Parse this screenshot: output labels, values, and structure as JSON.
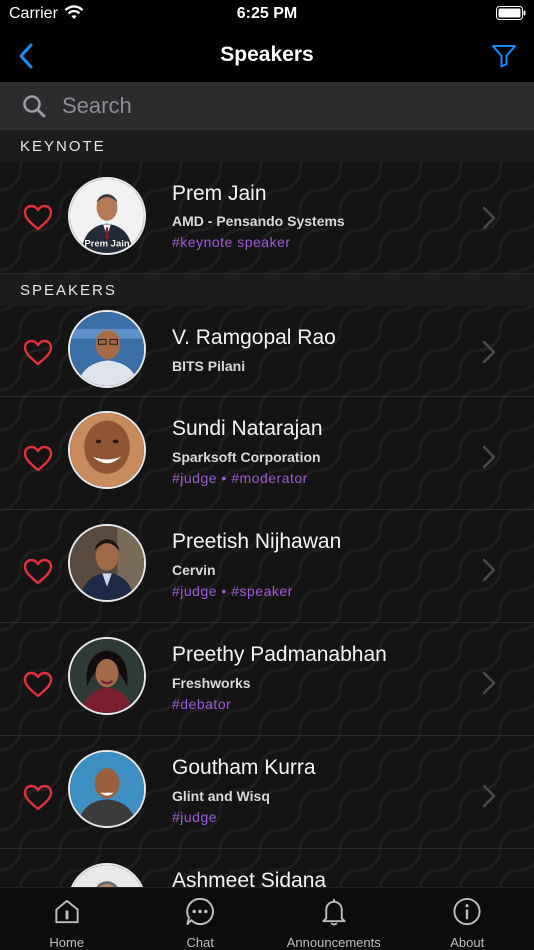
{
  "status_bar": {
    "carrier": "Carrier",
    "time": "6:25 PM"
  },
  "nav": {
    "title": "Speakers"
  },
  "search": {
    "placeholder": "Search"
  },
  "colors": {
    "accent_blue": "#1a8cff",
    "tag_purple": "#a259d6",
    "heart_red": "#e0303a"
  },
  "sections": [
    {
      "title": "KEYNOTE",
      "speakers": [
        {
          "name": "Prem  Jain",
          "org": "AMD - Pensando Systems",
          "tags": "#keynote speaker",
          "photo_caption": "Prem Jain"
        }
      ]
    },
    {
      "title": "SPEAKERS",
      "speakers": [
        {
          "name": "V. Ramgopal Rao",
          "org": "BITS Pilani",
          "tags": ""
        },
        {
          "name": "Sundi Natarajan",
          "org": "Sparksoft Corporation",
          "tags": "#judge • #moderator"
        },
        {
          "name": "Preetish Nijhawan",
          "org": "Cervin",
          "tags": "#judge • #speaker"
        },
        {
          "name": "Preethy Padmanabhan",
          "org": "Freshworks",
          "tags": "#debator"
        },
        {
          "name": "Goutham Kurra",
          "org": "Glint and Wisq",
          "tags": "#judge"
        },
        {
          "name": "Ashmeet Sidana",
          "org": "",
          "tags": ""
        }
      ]
    }
  ],
  "tab_bar": {
    "tabs": [
      {
        "label": "Home",
        "icon": "home-icon"
      },
      {
        "label": "Chat",
        "icon": "chat-icon"
      },
      {
        "label": "Announcements",
        "icon": "bell-icon"
      },
      {
        "label": "About",
        "icon": "info-icon"
      }
    ]
  }
}
